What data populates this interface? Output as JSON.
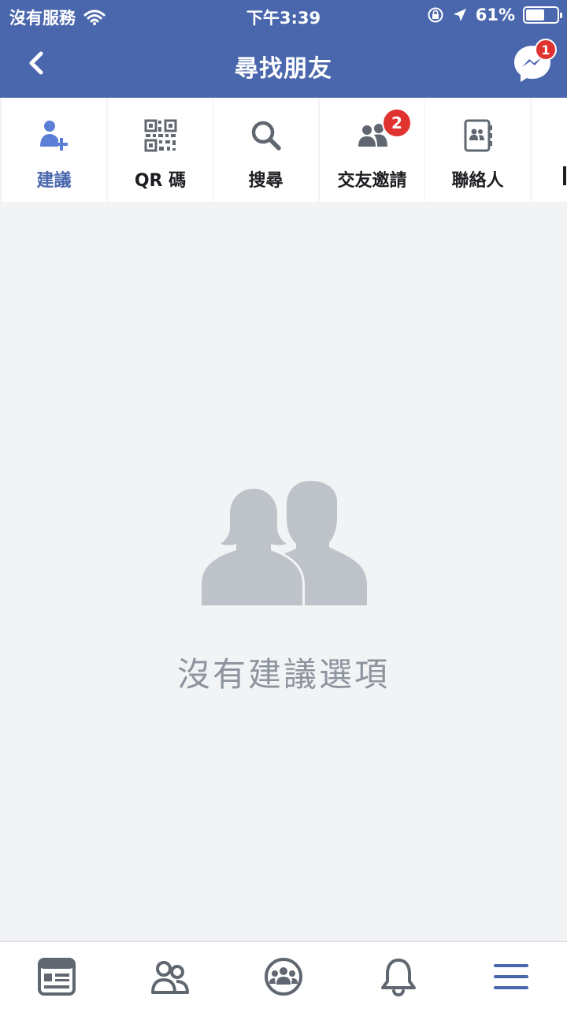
{
  "status_bar": {
    "carrier": "沒有服務",
    "time": "下午3:39",
    "battery": "61%",
    "battery_level": 0.61
  },
  "nav": {
    "title": "尋找朋友",
    "messenger_badge": "1"
  },
  "tabs": [
    {
      "label": "建議",
      "icon": "add-friend-icon",
      "active": true
    },
    {
      "label": "QR 碼",
      "icon": "qr-code-icon"
    },
    {
      "label": "搜尋",
      "icon": "search-icon"
    },
    {
      "label": "交友邀請",
      "icon": "friend-requests-icon",
      "badge": "2"
    },
    {
      "label": "聯絡人",
      "icon": "contacts-icon"
    },
    {
      "label": "",
      "icon": "more-tab-partial"
    }
  ],
  "empty_state": {
    "text": "沒有建議選項",
    "icon": "people-silhouette-icon"
  },
  "bottom_nav": [
    {
      "icon": "news-feed-icon"
    },
    {
      "icon": "friends-icon"
    },
    {
      "icon": "groups-icon"
    },
    {
      "icon": "notifications-bell-icon"
    },
    {
      "icon": "menu-icon",
      "active": true
    }
  ],
  "colors": {
    "header": "#4a67ad",
    "accent": "#4a67ad",
    "badge": "#e0322f",
    "background": "#f2f3f5",
    "muted": "#8d949e"
  }
}
